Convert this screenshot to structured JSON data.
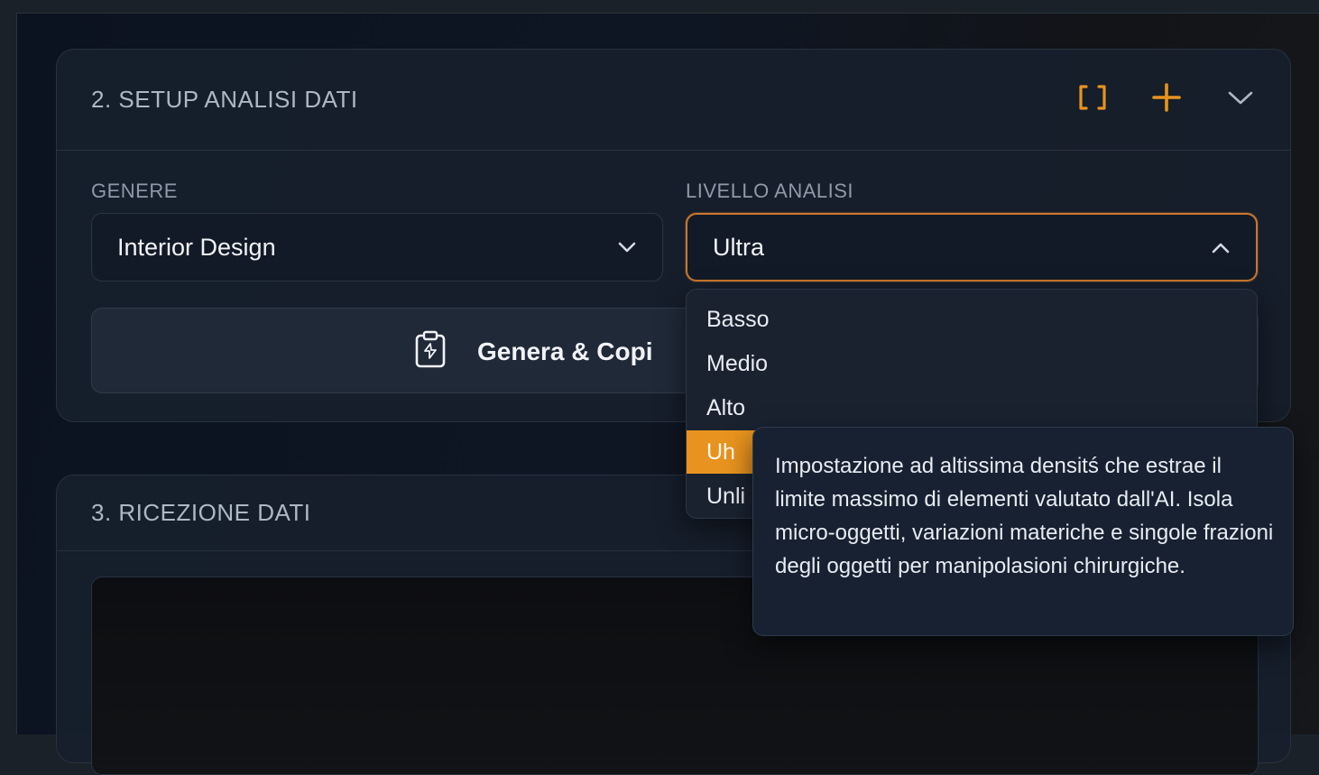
{
  "setup": {
    "title": "2. SETUP ANALISI DATI",
    "icons": [
      "brackets-icon",
      "plus-icon",
      "chevron-down-icon"
    ],
    "genere": {
      "label": "GENERE",
      "value": "Interior Design"
    },
    "livello": {
      "label": "LIVELLO ANALISI",
      "value": "Ultra"
    },
    "generate_button": {
      "label": "Genera & Copi"
    }
  },
  "dropdown": {
    "options": [
      "Basso",
      "Medio",
      "Alto",
      "Uh",
      "Unli"
    ],
    "selected_index": 3
  },
  "tooltip": {
    "text": "Impostazione ad altissima densitś che estrae il limite massimo di elementi valutato dall'AI. Isola micro-oggetti, variazioni materiche e singole frazioni degli oggetti per manipolasioni chirurgiche."
  },
  "recv": {
    "title": "3. RICEZIONE DATI"
  },
  "colors": {
    "accent": "#e8931f",
    "focus_border": "#c9782e",
    "background": "#0b1220"
  }
}
